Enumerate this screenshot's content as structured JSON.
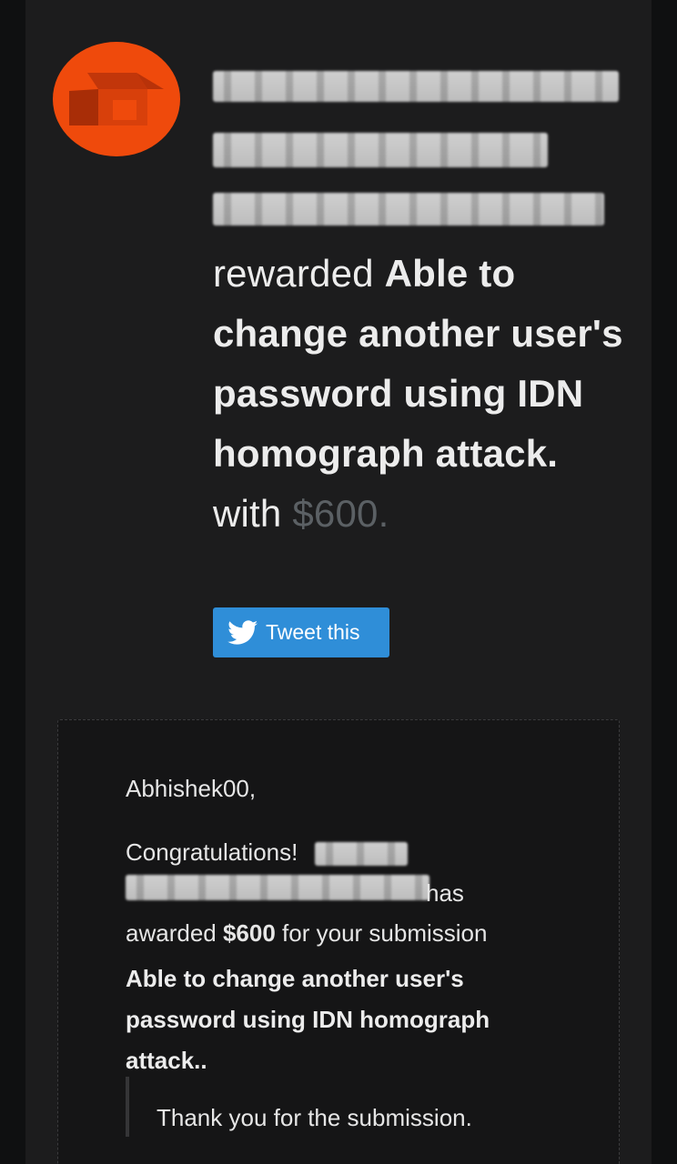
{
  "headline": {
    "verb": "rewarded",
    "title": "Able to change another user's password using IDN homograph attack.",
    "with_word": "with",
    "amount": "$600."
  },
  "tweet_button": {
    "label": "Tweet this"
  },
  "message": {
    "greeting": "Abhishek00,",
    "congrats": "Congratulations!",
    "has_fragment": "has",
    "awarded_prefix": "awarded",
    "awarded_amount": "$600",
    "awarded_suffix": "for your submission",
    "submission_title": "Able to change another user's password using IDN homograph attack..",
    "quote": "Thank you for the submission."
  },
  "colors": {
    "logo": "#ef4a0c",
    "tweet_button": "#2f8ed8",
    "background": "#1c1c1d"
  },
  "icons": {
    "logo": "bugcrowd-logo-icon",
    "tweet": "twitter-bird-icon"
  }
}
